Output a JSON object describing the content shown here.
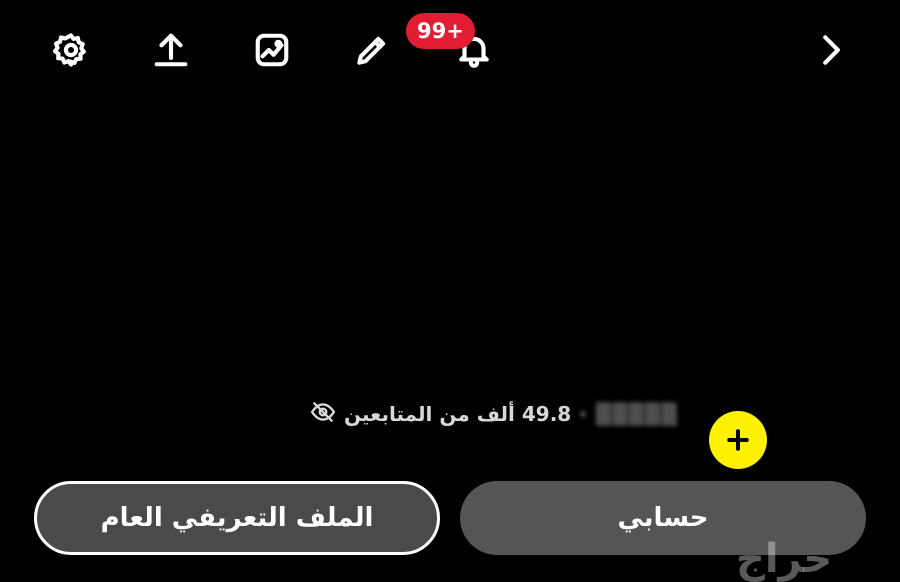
{
  "toolbar": {
    "icons": [
      "gear-icon",
      "upload-icon",
      "image-icon",
      "pencil-icon",
      "bell-icon",
      "chevron-right-icon"
    ],
    "notifications_badge": "99+"
  },
  "profile": {
    "name_blurred": "·",
    "followers_text": "49.8 ألف من المتابعين",
    "visibility_icon": "eye-off-icon"
  },
  "actions": {
    "public_profile_label": "الملف التعريفي العام",
    "my_account_label": "حسابي",
    "add_icon": "plus-icon"
  },
  "watermark": {
    "text": "حراج"
  },
  "colors": {
    "background": "#000000",
    "badge": "#e11d34",
    "add_button": "#fff200",
    "pill_dark": "#4a4a4a",
    "pill_gray": "#555555"
  }
}
